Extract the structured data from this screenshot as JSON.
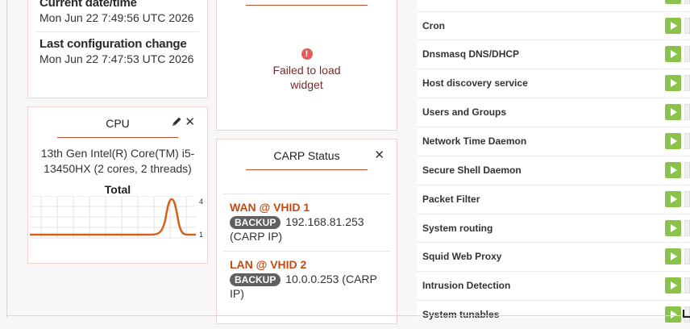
{
  "system": {
    "date_label": "Current date/time",
    "date_value": "Mon Jun 22 7:49:56 UTC 2026",
    "config_label": "Last configuration change",
    "config_value": "Mon Jun 22 7:47:53 UTC 2026"
  },
  "cpu": {
    "title": "CPU",
    "model": "13th Gen Intel(R) Core(TM) i5-13450HX (2 cores, 2 threads)",
    "graph_title": "Total",
    "y_max": "4",
    "y_min": "1",
    "edit_icon": "pencil-icon",
    "close_icon": "close-icon"
  },
  "failed": {
    "icon": "!",
    "message": "Failed to load widget"
  },
  "carp": {
    "title": "CARP Status",
    "items": [
      {
        "interface": "WAN @ VHID 1",
        "status": "BACKUP",
        "address": "192.168.81.253 (CARP IP)"
      },
      {
        "interface": "LAN @ VHID 2",
        "status": "BACKUP",
        "address": "10.0.0.253 (CARP IP)"
      }
    ]
  },
  "services": [
    "Cron",
    "Dnsmasq DNS/DHCP",
    "Host discovery service",
    "Users and Groups",
    "Network Time Daemon",
    "Secure Shell Daemon",
    "Packet Filter",
    "System routing",
    "Squid Web Proxy",
    "Intrusion Detection",
    "System tunables"
  ],
  "colors": {
    "accent": "#c9502c",
    "carp_interface": "#c44b11",
    "play_button": "#8bc34a",
    "badge": "#606060",
    "fail_icon": "#e35c5c"
  }
}
